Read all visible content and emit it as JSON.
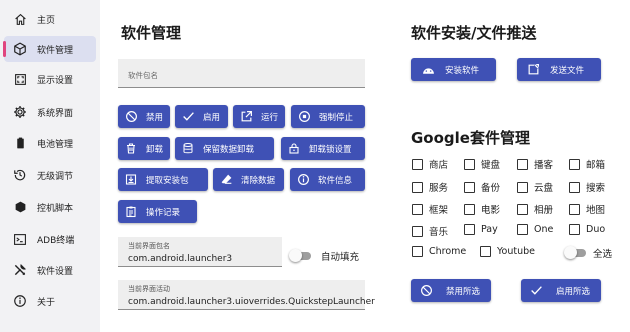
{
  "sidebar": {
    "items": [
      {
        "label": "主页",
        "icon": "home-icon"
      },
      {
        "label": "软件管理",
        "icon": "package-icon",
        "active": true
      },
      {
        "label": "显示设置",
        "icon": "display-icon"
      },
      {
        "label": "系统界面",
        "icon": "gear-icon"
      },
      {
        "label": "电池管理",
        "icon": "battery-icon"
      },
      {
        "label": "无级调节",
        "icon": "history-icon"
      },
      {
        "label": "控机脚本",
        "icon": "hexagon-icon"
      },
      {
        "label": "ADB终端",
        "icon": "terminal-icon"
      },
      {
        "label": "软件设置",
        "icon": "tools-icon"
      },
      {
        "label": "关于",
        "icon": "info-icon"
      }
    ]
  },
  "software": {
    "title": "软件管理",
    "package_placeholder": "软件包名",
    "buttons": {
      "disable": "禁用",
      "enable": "启用",
      "run": "运行",
      "force_stop": "强制停止",
      "uninstall": "卸载",
      "keep_data_uninstall": "保留数据卸载",
      "uninstall_lock": "卸载锁设置",
      "extract_apk": "提取安装包",
      "clear_data": "清除数据",
      "app_info": "软件信息",
      "op_log": "操作记录"
    },
    "current_package": {
      "caption": "当前界面包名",
      "value": "com.android.launcher3"
    },
    "autofill_label": "自动填充",
    "current_activity": {
      "caption": "当前界面活动",
      "value": "com.android.launcher3.uioverrides.QuickstepLauncher"
    }
  },
  "install": {
    "title": "软件安装/文件推送",
    "install_button": "安装软件",
    "push_button": "发送文件"
  },
  "google": {
    "title": "Google套件管理",
    "items": [
      "商店",
      "键盘",
      "播客",
      "邮箱",
      "服务",
      "备份",
      "云盘",
      "搜索",
      "框架",
      "电影",
      "相册",
      "地图",
      "音乐",
      "Pay",
      "One",
      "Duo",
      "Chrome",
      "Youtube"
    ],
    "select_all_label": "全选",
    "disable_selected": "禁用所选",
    "enable_selected": "启用所选"
  },
  "colors": {
    "accent": "#3f51b5",
    "active_indicator": "#e0457f",
    "sidebar_bg": "#f2f2f4",
    "active_bg": "#dcdff0"
  }
}
